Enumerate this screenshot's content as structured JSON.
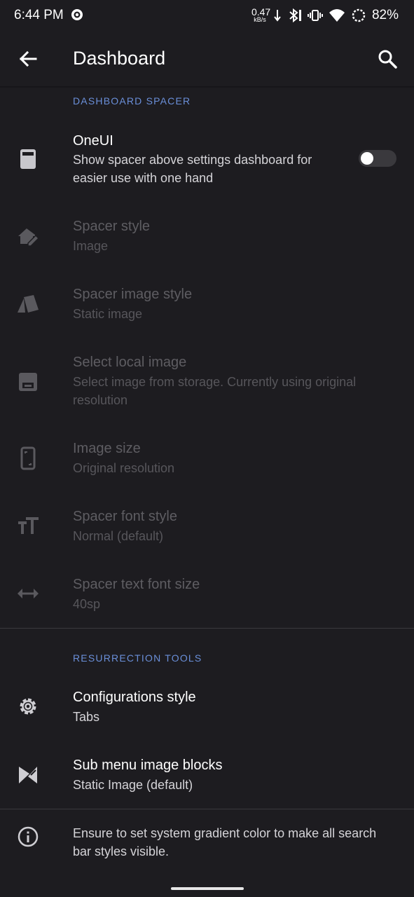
{
  "status_bar": {
    "time": "6:44 PM",
    "net_speed_value": "0.47",
    "net_speed_unit": "kB/s",
    "battery": "82%"
  },
  "app_bar": {
    "title": "Dashboard",
    "back_icon": "arrow-back-icon",
    "search_icon": "search-icon"
  },
  "sections": {
    "spacer_header": "DASHBOARD SPACER",
    "tools_header": "RESURRECTION TOOLS"
  },
  "oneui": {
    "title": "OneUI",
    "summary": "Show spacer above settings dashboard for easier use with one hand",
    "toggle_on": false
  },
  "spacer_items": [
    {
      "title": "Spacer style",
      "summary": "Image",
      "icon": "home-edit-icon"
    },
    {
      "title": "Spacer image style",
      "summary": "Static image",
      "icon": "style-icon"
    },
    {
      "title": "Select local image",
      "summary": "Select image from storage. Currently using original resolution",
      "icon": "wallpaper-icon"
    },
    {
      "title": "Image size",
      "summary": "Original resolution",
      "icon": "phone-crop-icon"
    },
    {
      "title": "Spacer font style",
      "summary": "Normal (default)",
      "icon": "text-size-icon"
    },
    {
      "title": "Spacer text font size",
      "summary": "40sp",
      "icon": "horizontal-arrows-icon"
    }
  ],
  "tools_items": [
    {
      "title": "Configurations style",
      "summary": "Tabs",
      "icon": "gear-icon"
    },
    {
      "title": "Sub menu image blocks",
      "summary": "Static Image (default)",
      "icon": "image-blocks-icon"
    }
  ],
  "footer": {
    "text": "Ensure to set system gradient color to make all search bar styles visible.",
    "icon": "info-icon"
  },
  "colors": {
    "background": "#1d1c20",
    "accent": "#6a8fd9",
    "disabled_text": "#5e5d62"
  }
}
